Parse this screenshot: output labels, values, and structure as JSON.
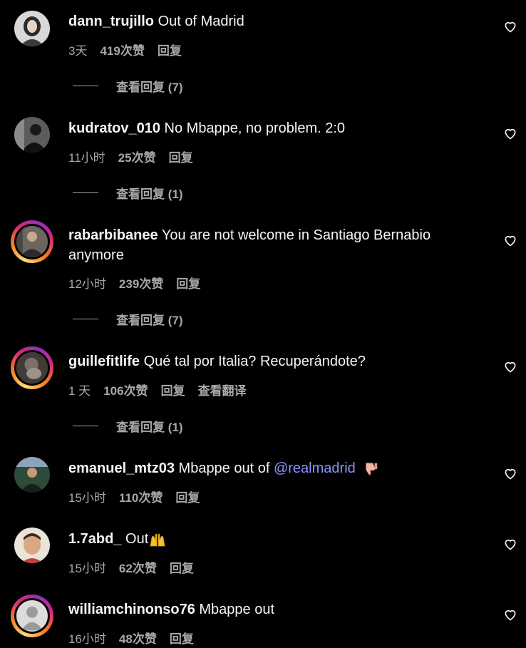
{
  "comments": [
    {
      "username": "dann_trujillo",
      "text": "Out of Madrid",
      "time": "3天",
      "likes": "419次赞",
      "reply": "回复",
      "view_replies": "查看回复 (7)"
    },
    {
      "username": "kudratov_010",
      "text": "No Mbappe, no problem. 2:0",
      "time": "11小时",
      "likes": "25次赞",
      "reply": "回复",
      "view_replies": "查看回复 (1)"
    },
    {
      "username": "rabarbibanee",
      "text": "You are not welcome in Santiago Bernabio anymore",
      "time": "12小时",
      "likes": "239次赞",
      "reply": "回复",
      "view_replies": "查看回复 (7)"
    },
    {
      "username": "guillefitlife",
      "text": "Qué tal por Italia? Recuperándote?",
      "time": "1 天",
      "likes": "106次赞",
      "reply": "回复",
      "translate": "查看翻译",
      "view_replies": "查看回复 (1)"
    },
    {
      "username": "emanuel_mtz03",
      "text": "Mbappe out of",
      "mention": "@realmadrid",
      "emoji": "thumbs-down-icon",
      "time": "15小时",
      "likes": "110次赞",
      "reply": "回复"
    },
    {
      "username": "1.7abd_",
      "text": "Out",
      "emoji": "raised-hands-icon",
      "time": "15小时",
      "likes": "62次赞",
      "reply": "回复"
    },
    {
      "username": "williamchinonso76",
      "text": "Mbappe out",
      "time": "16小时",
      "likes": "48次赞",
      "reply": "回复"
    }
  ],
  "colors": {
    "background": "#000000",
    "text": "#f5f5f5",
    "secondary": "#a8a8a8",
    "mention": "#8a94ff"
  }
}
